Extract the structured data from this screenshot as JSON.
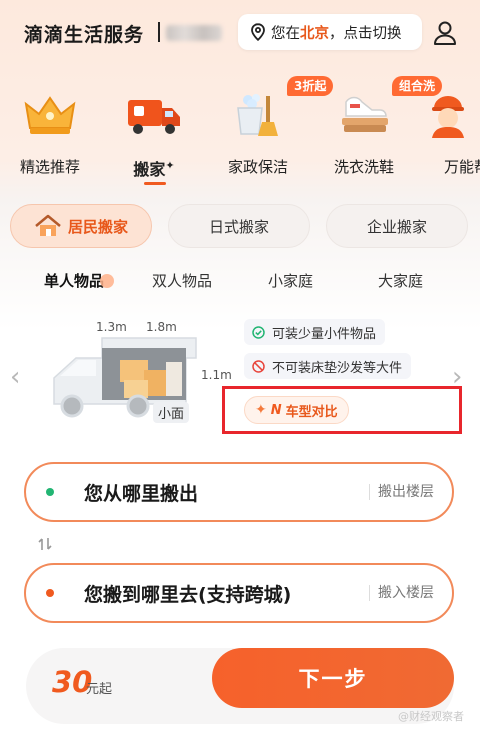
{
  "header": {
    "app_title": "滴滴生活服务",
    "city_prefix": "您在",
    "city": "北京",
    "city_suffix": "，点击切换"
  },
  "categories": [
    {
      "label": "精选推荐",
      "icon": "crown-icon",
      "active": false
    },
    {
      "label": "搬家",
      "icon": "moving-truck-icon",
      "active": true
    },
    {
      "label": "家政保洁",
      "icon": "cleaning-bucket-icon",
      "active": false,
      "badge": "3折起"
    },
    {
      "label": "洗衣洗鞋",
      "icon": "laundry-shoes-icon",
      "active": false,
      "badge": "组合洗"
    },
    {
      "label": "万能帮",
      "icon": "worker-avatar-icon",
      "active": false
    }
  ],
  "move_types": [
    {
      "label": "居民搬家",
      "active": true,
      "icon": "house-icon"
    },
    {
      "label": "日式搬家",
      "active": false
    },
    {
      "label": "企业搬家",
      "active": false
    }
  ],
  "size_tabs": [
    {
      "label": "单人物品",
      "active": true
    },
    {
      "label": "双人物品",
      "active": false
    },
    {
      "label": "小家庭",
      "active": false
    },
    {
      "label": "大家庭",
      "active": false
    }
  ],
  "vehicle": {
    "name": "小面",
    "length": "1.3m",
    "width": "1.8m",
    "height": "1.1m",
    "features": [
      {
        "text": "可装少量小件物品",
        "icon": "check-circle-icon",
        "color": "#22b573"
      },
      {
        "text": "不可装床垫沙发等大件",
        "icon": "no-entry-icon",
        "color": "#e8453c"
      }
    ],
    "compare_label": "车型对比"
  },
  "address": {
    "from_label": "您从哪里搬出",
    "from_floor": "搬出楼层",
    "to_label": "您搬到哪里去(支持跨城)",
    "to_floor": "搬入楼层"
  },
  "footer": {
    "price": "30",
    "price_unit": "元起",
    "next_label": "下一步",
    "watermark": "@财经观察者"
  },
  "colors": {
    "accent": "#f05a1f",
    "from_dot": "#22b573",
    "to_dot": "#f05a1f",
    "highlight_box": "#e8262c"
  }
}
